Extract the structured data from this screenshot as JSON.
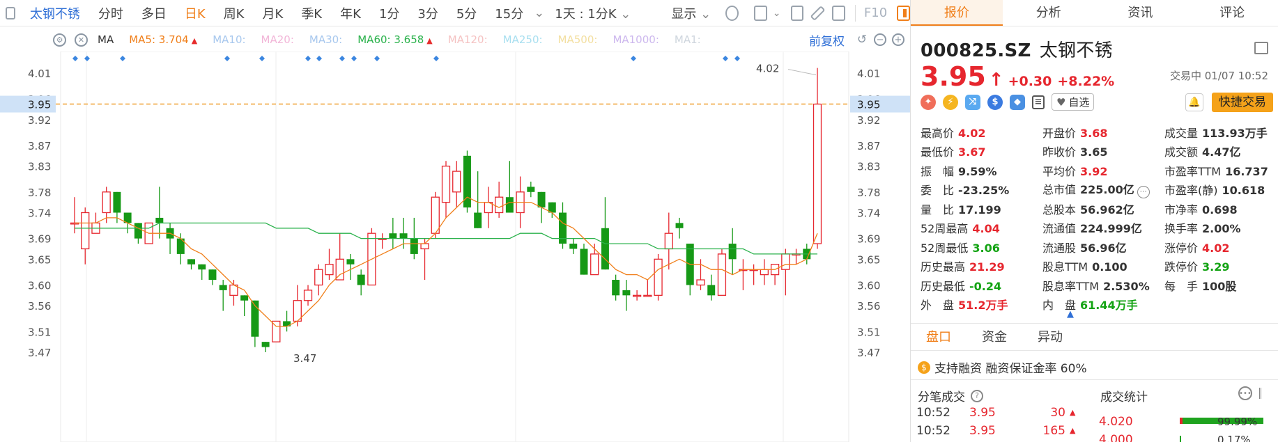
{
  "toolbar": {
    "stock_name": "太钢不锈",
    "periods": [
      "分时",
      "多日",
      "日K",
      "周K",
      "月K",
      "季K",
      "年K",
      "1分",
      "3分",
      "5分",
      "15分"
    ],
    "active_period": "日K",
    "interval_select": "1天 : 1分K",
    "display_label": "显示",
    "f10_label": "F10"
  },
  "ma_row": {
    "ma_label": "MA",
    "items": [
      {
        "label": "MA5:",
        "value": "3.704",
        "color": "#f07f1a",
        "active": true
      },
      {
        "label": "MA10:",
        "value": "",
        "color": "#a8c8ee",
        "active": false
      },
      {
        "label": "MA20:",
        "value": "",
        "color": "#f2b6d8",
        "active": false
      },
      {
        "label": "MA30:",
        "value": "",
        "color": "#a8c8ee",
        "active": false
      },
      {
        "label": "MA60:",
        "value": "3.658",
        "color": "#2bb24c",
        "active": true
      },
      {
        "label": "MA120:",
        "value": "",
        "color": "#f5c3c3",
        "active": false
      },
      {
        "label": "MA250:",
        "value": "",
        "color": "#a8dff0",
        "active": false
      },
      {
        "label": "MA500:",
        "value": "",
        "color": "#f3dfa0",
        "active": false
      },
      {
        "label": "MA1000:",
        "value": "",
        "color": "#cdb8ee",
        "active": false
      },
      {
        "label": "MA1:",
        "value": "",
        "color": "#cfd6de",
        "active": false
      }
    ],
    "adjust_label": "前复权"
  },
  "chart_data": {
    "type": "candlestick",
    "y_ticks": [
      "4.01",
      "3.96",
      "3.92",
      "3.87",
      "3.83",
      "3.78",
      "3.74",
      "3.69",
      "3.65",
      "3.60",
      "3.56",
      "3.51",
      "3.47"
    ],
    "current_price_label": "3.95",
    "max_label": "4.02",
    "min_label": "3.47",
    "ylim": [
      3.45,
      4.04
    ],
    "candles": [
      {
        "o": 3.72,
        "c": 3.72,
        "h": 3.77,
        "l": 3.7
      },
      {
        "o": 3.67,
        "c": 3.74,
        "h": 3.75,
        "l": 3.64
      },
      {
        "o": 3.7,
        "c": 3.72,
        "h": 3.74,
        "l": 3.7
      },
      {
        "o": 3.74,
        "c": 3.78,
        "h": 3.79,
        "l": 3.72
      },
      {
        "o": 3.78,
        "c": 3.74,
        "h": 3.78,
        "l": 3.72
      },
      {
        "o": 3.74,
        "c": 3.72,
        "h": 3.74,
        "l": 3.7
      },
      {
        "o": 3.72,
        "c": 3.69,
        "h": 3.72,
        "l": 3.68
      },
      {
        "o": 3.68,
        "c": 3.72,
        "h": 3.72,
        "l": 3.68
      },
      {
        "o": 3.73,
        "c": 3.72,
        "h": 3.79,
        "l": 3.69
      },
      {
        "o": 3.71,
        "c": 3.69,
        "h": 3.72,
        "l": 3.66
      },
      {
        "o": 3.69,
        "c": 3.66,
        "h": 3.7,
        "l": 3.64
      },
      {
        "o": 3.65,
        "c": 3.64,
        "h": 3.65,
        "l": 3.63
      },
      {
        "o": 3.64,
        "c": 3.63,
        "h": 3.64,
        "l": 3.61
      },
      {
        "o": 3.63,
        "c": 3.61,
        "h": 3.63,
        "l": 3.6
      },
      {
        "o": 3.6,
        "c": 3.59,
        "h": 3.61,
        "l": 3.55
      },
      {
        "o": 3.58,
        "c": 3.6,
        "h": 3.61,
        "l": 3.56
      },
      {
        "o": 3.58,
        "c": 3.57,
        "h": 3.58,
        "l": 3.54
      },
      {
        "o": 3.57,
        "c": 3.5,
        "h": 3.57,
        "l": 3.48
      },
      {
        "o": 3.49,
        "c": 3.48,
        "h": 3.49,
        "l": 3.47
      },
      {
        "o": 3.49,
        "c": 3.53,
        "h": 3.53,
        "l": 3.49
      },
      {
        "o": 3.53,
        "c": 3.52,
        "h": 3.55,
        "l": 3.51
      },
      {
        "o": 3.53,
        "c": 3.57,
        "h": 3.6,
        "l": 3.52
      },
      {
        "o": 3.57,
        "c": 3.59,
        "h": 3.6,
        "l": 3.56
      },
      {
        "o": 3.6,
        "c": 3.63,
        "h": 3.64,
        "l": 3.58
      },
      {
        "o": 3.62,
        "c": 3.64,
        "h": 3.67,
        "l": 3.61
      },
      {
        "o": 3.61,
        "c": 3.65,
        "h": 3.7,
        "l": 3.61
      },
      {
        "o": 3.65,
        "c": 3.64,
        "h": 3.66,
        "l": 3.61
      },
      {
        "o": 3.62,
        "c": 3.6,
        "h": 3.63,
        "l": 3.58
      },
      {
        "o": 3.6,
        "c": 3.7,
        "h": 3.71,
        "l": 3.6
      },
      {
        "o": 3.69,
        "c": 3.69,
        "h": 3.7,
        "l": 3.67
      },
      {
        "o": 3.7,
        "c": 3.69,
        "h": 3.73,
        "l": 3.67
      },
      {
        "o": 3.7,
        "c": 3.69,
        "h": 3.73,
        "l": 3.67
      },
      {
        "o": 3.69,
        "c": 3.66,
        "h": 3.73,
        "l": 3.65
      },
      {
        "o": 3.67,
        "c": 3.68,
        "h": 3.69,
        "l": 3.61
      },
      {
        "o": 3.7,
        "c": 3.77,
        "h": 3.78,
        "l": 3.69
      },
      {
        "o": 3.76,
        "c": 3.83,
        "h": 3.84,
        "l": 3.73
      },
      {
        "o": 3.78,
        "c": 3.82,
        "h": 3.84,
        "l": 3.75
      },
      {
        "o": 3.85,
        "c": 3.75,
        "h": 3.86,
        "l": 3.74
      },
      {
        "o": 3.74,
        "c": 3.71,
        "h": 3.82,
        "l": 3.71
      },
      {
        "o": 3.74,
        "c": 3.76,
        "h": 3.79,
        "l": 3.71
      },
      {
        "o": 3.74,
        "c": 3.77,
        "h": 3.8,
        "l": 3.73
      },
      {
        "o": 3.77,
        "c": 3.74,
        "h": 3.84,
        "l": 3.74
      },
      {
        "o": 3.74,
        "c": 3.78,
        "h": 3.81,
        "l": 3.71
      },
      {
        "o": 3.79,
        "c": 3.78,
        "h": 3.8,
        "l": 3.77
      },
      {
        "o": 3.78,
        "c": 3.75,
        "h": 3.78,
        "l": 3.72
      },
      {
        "o": 3.76,
        "c": 3.74,
        "h": 3.76,
        "l": 3.73
      },
      {
        "o": 3.74,
        "c": 3.68,
        "h": 3.76,
        "l": 3.67
      },
      {
        "o": 3.68,
        "c": 3.67,
        "h": 3.69,
        "l": 3.66
      },
      {
        "o": 3.67,
        "c": 3.62,
        "h": 3.68,
        "l": 3.62
      },
      {
        "o": 3.62,
        "c": 3.66,
        "h": 3.68,
        "l": 3.62
      },
      {
        "o": 3.71,
        "c": 3.63,
        "h": 3.77,
        "l": 3.63
      },
      {
        "o": 3.61,
        "c": 3.58,
        "h": 3.62,
        "l": 3.57
      },
      {
        "o": 3.59,
        "c": 3.58,
        "h": 3.61,
        "l": 3.55
      },
      {
        "o": 3.58,
        "c": 3.58,
        "h": 3.59,
        "l": 3.57
      },
      {
        "o": 3.58,
        "c": 3.58,
        "h": 3.61,
        "l": 3.58
      },
      {
        "o": 3.58,
        "c": 3.65,
        "h": 3.66,
        "l": 3.57
      },
      {
        "o": 3.67,
        "c": 3.7,
        "h": 3.74,
        "l": 3.63
      },
      {
        "o": 3.72,
        "c": 3.71,
        "h": 3.73,
        "l": 3.69
      },
      {
        "o": 3.68,
        "c": 3.6,
        "h": 3.68,
        "l": 3.58
      },
      {
        "o": 3.6,
        "c": 3.61,
        "h": 3.65,
        "l": 3.59
      },
      {
        "o": 3.6,
        "c": 3.58,
        "h": 3.62,
        "l": 3.57
      },
      {
        "o": 3.58,
        "c": 3.66,
        "h": 3.67,
        "l": 3.58
      },
      {
        "o": 3.68,
        "c": 3.65,
        "h": 3.71,
        "l": 3.62
      },
      {
        "o": 3.63,
        "c": 3.63,
        "h": 3.65,
        "l": 3.59
      },
      {
        "o": 3.63,
        "c": 3.63,
        "h": 3.64,
        "l": 3.6
      },
      {
        "o": 3.62,
        "c": 3.63,
        "h": 3.65,
        "l": 3.6
      },
      {
        "o": 3.62,
        "c": 3.64,
        "h": 3.64,
        "l": 3.6
      },
      {
        "o": 3.63,
        "c": 3.66,
        "h": 3.67,
        "l": 3.58
      },
      {
        "o": 3.66,
        "c": 3.66,
        "h": 3.67,
        "l": 3.64
      },
      {
        "o": 3.67,
        "c": 3.65,
        "h": 3.68,
        "l": 3.64
      },
      {
        "o": 3.68,
        "c": 3.95,
        "h": 4.02,
        "l": 3.67
      }
    ],
    "ma5": [
      3.72,
      3.72,
      3.72,
      3.73,
      3.73,
      3.72,
      3.71,
      3.7,
      3.7,
      3.7,
      3.69,
      3.67,
      3.66,
      3.64,
      3.62,
      3.6,
      3.59,
      3.56,
      3.54,
      3.52,
      3.52,
      3.53,
      3.55,
      3.57,
      3.6,
      3.62,
      3.63,
      3.64,
      3.65,
      3.66,
      3.67,
      3.68,
      3.68,
      3.68,
      3.7,
      3.73,
      3.75,
      3.77,
      3.76,
      3.76,
      3.75,
      3.76,
      3.76,
      3.76,
      3.75,
      3.74,
      3.72,
      3.71,
      3.69,
      3.67,
      3.65,
      3.63,
      3.62,
      3.62,
      3.61,
      3.63,
      3.64,
      3.65,
      3.64,
      3.64,
      3.63,
      3.63,
      3.62,
      3.63,
      3.63,
      3.63,
      3.63,
      3.64,
      3.64,
      3.65,
      3.7
    ],
    "ma60": [
      3.71,
      3.71,
      3.71,
      3.71,
      3.71,
      3.71,
      3.71,
      3.71,
      3.72,
      3.72,
      3.72,
      3.72,
      3.72,
      3.72,
      3.72,
      3.72,
      3.72,
      3.72,
      3.72,
      3.71,
      3.71,
      3.71,
      3.71,
      3.7,
      3.7,
      3.7,
      3.7,
      3.69,
      3.69,
      3.69,
      3.69,
      3.69,
      3.69,
      3.69,
      3.69,
      3.69,
      3.69,
      3.69,
      3.69,
      3.69,
      3.69,
      3.69,
      3.7,
      3.7,
      3.7,
      3.69,
      3.69,
      3.69,
      3.69,
      3.69,
      3.68,
      3.68,
      3.68,
      3.68,
      3.68,
      3.67,
      3.67,
      3.67,
      3.67,
      3.67,
      3.67,
      3.67,
      3.67,
      3.67,
      3.66,
      3.66,
      3.66,
      3.66,
      3.66,
      3.66,
      3.66
    ]
  },
  "panel": {
    "tabs": [
      "报价",
      "分析",
      "资讯",
      "评论"
    ],
    "active_tab": "报价",
    "code": "000825.SZ",
    "name": "太钢不锈",
    "price": "3.95",
    "change": "+0.30",
    "change_pct": "+8.22%",
    "status": "交易中 01/07 10:52",
    "watch_label": "自选",
    "fast_trade_label": "快捷交易",
    "quote_rows": [
      [
        {
          "k": "最高价",
          "v": "4.02",
          "c": "red"
        },
        {
          "k": "开盘价",
          "v": "3.68",
          "c": "red"
        },
        {
          "k": "成交量",
          "v": "113.93万手",
          "c": "dark"
        }
      ],
      [
        {
          "k": "最低价",
          "v": "3.67",
          "c": "red"
        },
        {
          "k": "昨收价",
          "v": "3.65",
          "c": "dark"
        },
        {
          "k": "成交额",
          "v": "4.47亿",
          "c": "dark"
        }
      ],
      [
        {
          "k": "振　幅",
          "v": "9.59%",
          "c": "dark"
        },
        {
          "k": "平均价",
          "v": "3.92",
          "c": "red"
        },
        {
          "k": "市盈率TTM",
          "v": "16.737",
          "c": "dark"
        }
      ],
      [
        {
          "k": "委　比",
          "v": "-23.25%",
          "c": "dark"
        },
        {
          "k": "总市值",
          "v": "225.00亿",
          "c": "dark"
        },
        {
          "k": "市盈率(静)",
          "v": "10.618",
          "c": "dark"
        }
      ],
      [
        {
          "k": "量　比",
          "v": "17.199",
          "c": "dark"
        },
        {
          "k": "总股本",
          "v": "56.962亿",
          "c": "dark"
        },
        {
          "k": "市净率",
          "v": "0.698",
          "c": "dark"
        }
      ],
      [
        {
          "k": "52周最高",
          "v": "4.04",
          "c": "red"
        },
        {
          "k": "流通值",
          "v": "224.999亿",
          "c": "dark"
        },
        {
          "k": "换手率",
          "v": "2.00%",
          "c": "dark"
        }
      ],
      [
        {
          "k": "52周最低",
          "v": "3.06",
          "c": "green"
        },
        {
          "k": "流通股",
          "v": "56.96亿",
          "c": "dark"
        },
        {
          "k": "涨停价",
          "v": "4.02",
          "c": "red"
        }
      ],
      [
        {
          "k": "历史最高",
          "v": "21.29",
          "c": "red"
        },
        {
          "k": "股息TTM",
          "v": "0.100",
          "c": "dark"
        },
        {
          "k": "跌停价",
          "v": "3.29",
          "c": "green"
        }
      ],
      [
        {
          "k": "历史最低",
          "v": "-0.24",
          "c": "green"
        },
        {
          "k": "股息率TTM",
          "v": "2.530%",
          "c": "dark"
        },
        {
          "k": "每　手",
          "v": "100股",
          "c": "dark"
        }
      ],
      [
        {
          "k": "外　盘",
          "v": "51.2万手",
          "c": "red"
        },
        {
          "k": "内　盘",
          "v": "61.44万手",
          "c": "green"
        },
        {
          "k": "",
          "v": "",
          "c": "dark"
        }
      ]
    ],
    "sub_tabs": [
      "盘口",
      "资金",
      "异动"
    ],
    "active_sub_tab": "盘口",
    "margin_text": "支持融资 融资保证金率 60%",
    "trades_title": "分笔成交",
    "stats_title": "成交统计",
    "trades": [
      {
        "time": "10:52",
        "price": "3.95",
        "vol": "30"
      },
      {
        "time": "10:52",
        "price": "3.95",
        "vol": "165"
      }
    ],
    "stats": [
      {
        "price": "4.020",
        "pct": "99.99%"
      },
      {
        "price": "4.000",
        "pct": "0.17%"
      }
    ]
  }
}
